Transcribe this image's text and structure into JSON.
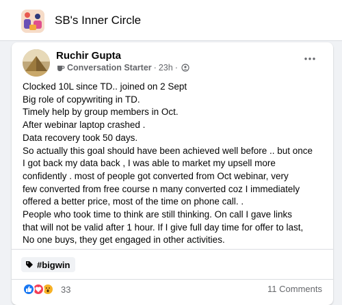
{
  "group": {
    "name": "SB's Inner Circle"
  },
  "post": {
    "author": "Ruchir Gupta",
    "badge": "Conversation Starter",
    "time": "23h",
    "separator": "·",
    "lines": [
      "Clocked 10L since TD.. joined on 2 Sept",
      "Big role of copywriting in TD.",
      "Timely help by group members in Oct.",
      "After webinar laptop crashed .",
      "Data recovery took 50 days.",
      "So actually this goal should have been achieved well before .. but once",
      "I got back my data back , I was able to market my upsell more",
      "confidently .  most of people got converted from Oct webinar,  very",
      "few converted from free course n many converted coz I immediately",
      "offered a better price, most of the time on phone call. .",
      "People who took time to think are still thinking. On call I gave links",
      "that will not be valid after 1 hour. If I give full day time for offer to last,",
      "No one buys, they get engaged in other activities."
    ],
    "hashtag": "#bigwin",
    "reaction_icons": [
      "like-icon",
      "love-icon",
      "wow-icon"
    ],
    "reaction_count": "33",
    "comments": "11 Comments"
  },
  "colors": {
    "background": "#f0f2f5",
    "card": "#ffffff",
    "text": "#050505",
    "secondary": "#65676b",
    "like_blue": "#1877f2",
    "love_red": "#f33e58",
    "wow_yellow": "#f7b125"
  }
}
